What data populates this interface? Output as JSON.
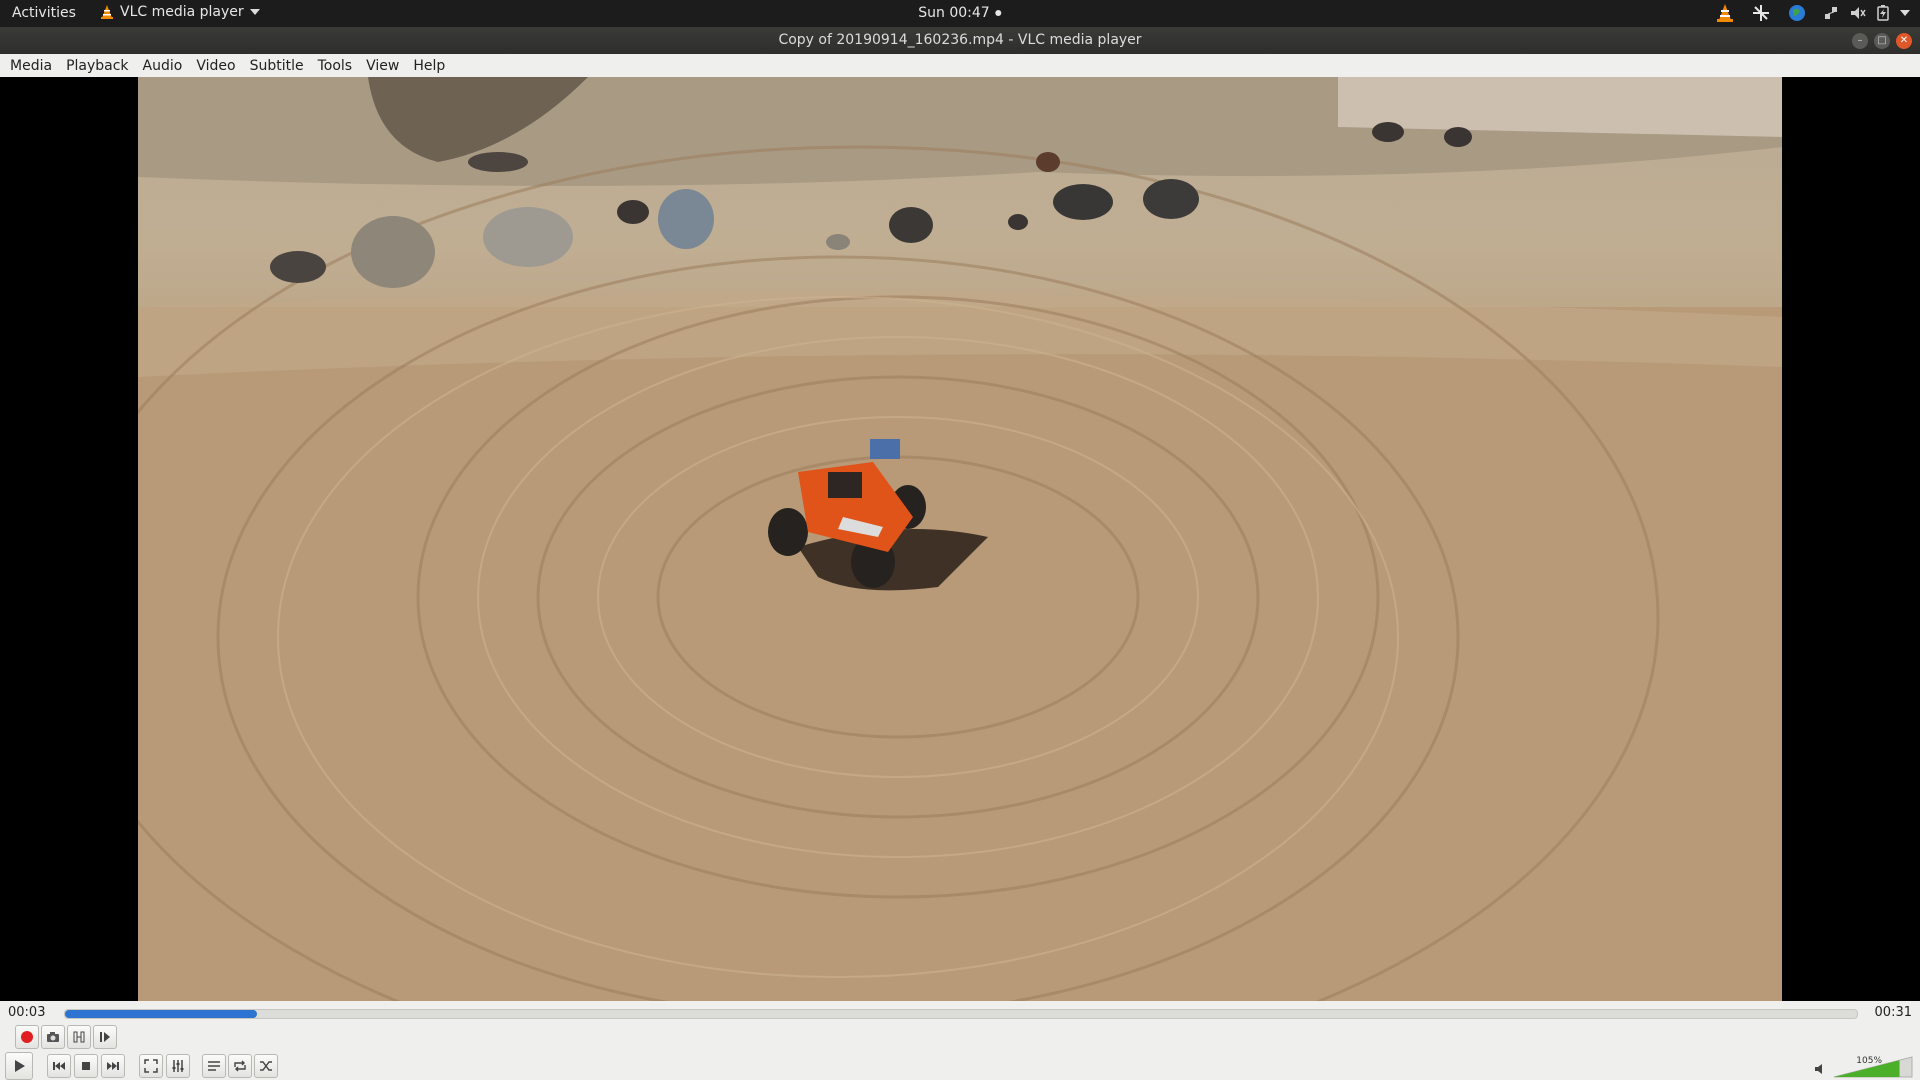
{
  "topbar": {
    "activities": "Activities",
    "app_name": "VLC media player",
    "clock": "Sun 00:47"
  },
  "window": {
    "title": "Copy of 20190914_160236.mp4 - VLC media player"
  },
  "menu": [
    "Media",
    "Playback",
    "Audio",
    "Video",
    "Subtitle",
    "Tools",
    "View",
    "Help"
  ],
  "playback": {
    "elapsed": "00:03",
    "total": "00:31",
    "progress": 0.107
  },
  "volume": {
    "label": "105%",
    "level": 1.05
  },
  "icons": {
    "record": "record-icon",
    "snapshot": "camera-icon",
    "loop_ab": "loop-ab-icon",
    "frame_step": "frame-step-icon",
    "play": "play-icon",
    "previous": "previous-icon",
    "stop": "stop-icon",
    "next": "next-icon",
    "fullscreen": "fullscreen-icon",
    "extended": "equalizer-icon",
    "playlist": "playlist-icon",
    "loop": "loop-icon",
    "shuffle": "shuffle-icon"
  },
  "colors": {
    "accent": "#2c73d2",
    "record": "#e02020",
    "vlc_orange": "#f08a00"
  }
}
